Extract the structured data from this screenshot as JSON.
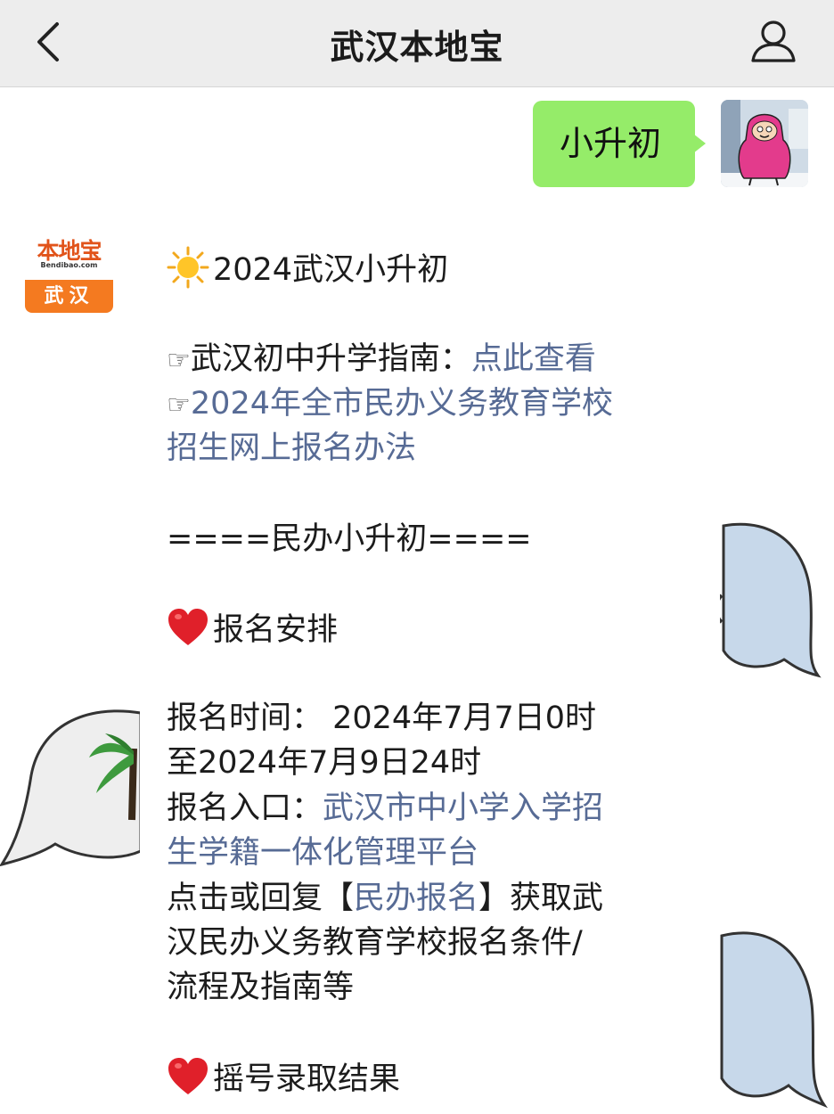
{
  "header": {
    "title": "武汉本地宝"
  },
  "outgoing_message": {
    "text": "小升初"
  },
  "account": {
    "logo_main": "本地宝",
    "logo_domain": "Bendibao.com",
    "logo_city": "武汉"
  },
  "reply": {
    "heading": "2024武汉小升初",
    "guide_prefix": "武汉初中升学指南：",
    "guide_link": "点此查看",
    "pointer_glyph": "☞",
    "policy_link_line1": "2024年全市民办义务教育学校",
    "policy_link_line2": "招生网上报名办法",
    "section_divider": "====民办小升初====",
    "section1_title": "报名安排",
    "time_line1": "报名时间： 2024年7月7日0时",
    "time_line2": "至2024年7月9日24时",
    "entry_prefix": "报名入口：",
    "entry_link_line1": "武汉市中小学入学招",
    "entry_link_line2": "生学籍一体化管理平台",
    "reply_prefix": "点击或回复【",
    "reply_link": "民办报名",
    "reply_suffix": "】获取武",
    "reply_line2": "汉民办义务教育学校报名条件/",
    "reply_line3": "流程及指南等",
    "section2_title": "摇号录取结果"
  },
  "colors": {
    "nav_background": "#ededed",
    "outgoing_bubble": "#95ec69",
    "link": "#576b95",
    "logo_orange": "#f47a20"
  },
  "icons": {
    "back": "chevron-left-icon",
    "profile": "person-icon",
    "sun": "sun-emoji-icon",
    "heart": "red-heart-emoji-icon"
  }
}
